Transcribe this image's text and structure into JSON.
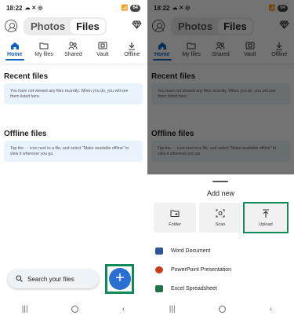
{
  "status": {
    "time": "18:22",
    "battery": "64"
  },
  "header": {
    "tab_photos": "Photos",
    "tab_files": "Files"
  },
  "nav_tabs": [
    {
      "label": "Home"
    },
    {
      "label": "My files"
    },
    {
      "label": "Shared"
    },
    {
      "label": "Vault"
    },
    {
      "label": "Offline"
    }
  ],
  "recent": {
    "title": "Recent files",
    "message": "You have not viewed any files recently. When you do, you will see them listed here."
  },
  "offline": {
    "title": "Offline files",
    "message_part1": "Tap the",
    "message_part2": "icon next to a file, and select \"Make available offline\" to view it wherever you go."
  },
  "search": {
    "label": "Search your files"
  },
  "fab": {
    "label": "+"
  },
  "sheet": {
    "title": "Add new",
    "options": [
      {
        "label": "Folder"
      },
      {
        "label": "Scan"
      },
      {
        "label": "Upload"
      }
    ],
    "documents": [
      {
        "label": "Word Document",
        "color": "#2b579a"
      },
      {
        "label": "PowerPoint Presentation",
        "color": "#c43e1c"
      },
      {
        "label": "Excel Spreadsheet",
        "color": "#217346"
      }
    ]
  },
  "colors": {
    "accent": "#1160c0",
    "highlight": "#118a5a",
    "fab": "#2b6fd3",
    "info_bg": "#e9f3fb"
  }
}
